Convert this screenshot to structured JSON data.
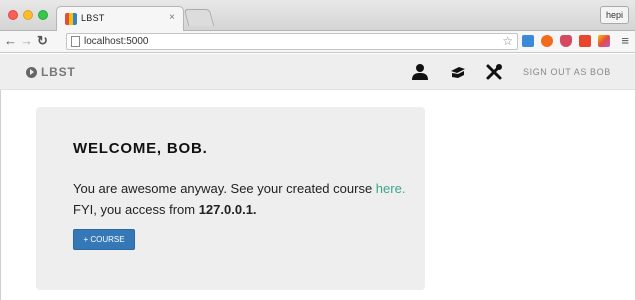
{
  "browser": {
    "tab_title": "LBST",
    "tab_close": "×",
    "profile": "hepi",
    "url": "localhost:5000",
    "nav_icons": [
      "back-icon",
      "forward-icon",
      "reload-icon"
    ],
    "extensions": [
      {
        "name": "checkmark-extension-icon",
        "color": "#3b8ad9"
      },
      {
        "name": "power-extension-icon",
        "color": "#f26b1d"
      },
      {
        "name": "pocket-extension-icon",
        "color": "#d64a5f"
      },
      {
        "name": "flag-extension-icon",
        "color": "#e8452c"
      },
      {
        "name": "multicolor-extension-icon",
        "color": "#b55be0"
      }
    ]
  },
  "navbar": {
    "brand": "LBST",
    "icons": [
      "user-icon",
      "education-icon",
      "tools-icon"
    ],
    "signout": "SIGN OUT AS BOB"
  },
  "main": {
    "welcome": "WELCOME, BOB.",
    "line1": "You are awesome anyway. See your created course",
    "link": "here.",
    "line2_pre": " FYI, you access from ",
    "ip": "127.0.0.1.",
    "course_button": "+ COURSE"
  },
  "colors": {
    "link": "#3aa78a",
    "button": "#3578b8"
  }
}
